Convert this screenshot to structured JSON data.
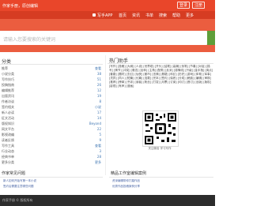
{
  "topbar": {
    "left_text": "作家手册，原创编辑",
    "login_label": "登录",
    "register_label": "注册"
  },
  "navbar": {
    "items": [
      "写手APP",
      "首页",
      "资讯",
      "书单",
      "搜索",
      "帮助",
      "更多"
    ]
  },
  "search": {
    "placeholder": "请输入您要搜索的关键词"
  },
  "left": {
    "title": "分类",
    "items": [
      {
        "k": "推荐",
        "v": "查看"
      },
      {
        "k": "小说分类",
        "v": "38"
      },
      {
        "k": "写作技巧",
        "v": "51"
      },
      {
        "k": "投稿指南",
        "v": "26"
      },
      {
        "k": "编辑推荐",
        "v": "12"
      },
      {
        "k": "出版资讯",
        "v": "19"
      },
      {
        "k": "作者访谈",
        "v": "8"
      },
      {
        "k": "签约相关",
        "v": "小说"
      },
      {
        "k": "新人必读",
        "v": "17"
      },
      {
        "k": "征文活动",
        "v": "14"
      },
      {
        "k": "版权知识",
        "v": "Beyond"
      },
      {
        "k": "网文平台",
        "v": "22"
      },
      {
        "k": "影视改编",
        "v": "5"
      },
      {
        "k": "读者反馈",
        "v": "9"
      },
      {
        "k": "写作工具",
        "v": "查看"
      },
      {
        "k": "行业动态",
        "v": "3"
      },
      {
        "k": "经典书单",
        "v": "28"
      },
      {
        "k": "更多分类",
        "v": "更多"
      }
    ]
  },
  "hot": {
    "title": "热门助手",
    "text": "[写作] [投稿] [大纲] [人设] [世界观] [开头] [结尾] [高潮] [伏笔] [节奏] [对话] [描写] [情节] [冲突] [悬念] [反转] [主角] [配角] [反派] [感情线] [升级] [金手指] [爽点] [套路] [题材] [玄幻] [仙侠] [都市] [言情] [悬疑] [科幻] [历史] [游戏] [体育] [军事] [灵异] [同人] [短篇] [长篇] [连载] [完本] [签约] [保底] [分成] [稿费] [编辑] [审核] [推荐] [榜单] [书评] [读者] [粉丝] [打赏] [月票] [订阅] [均订] [首订] [出版] [版权] [影视] [有声] [漫画]",
    "qr_caption": "关注微信 学习写作"
  },
  "bottom_left": {
    "title": "作家常见问题",
    "rows": [
      "新人如何开始写第一本小说",
      "签约后需要注意哪些问题"
    ]
  },
  "bottom_right": {
    "title": "精品工作室编辑案例",
    "rows": [
      "资深编辑带你打磨作品",
      "优秀作品投稿案例分享"
    ]
  },
  "footer": {
    "text": "作家手册 © 版权所有"
  }
}
